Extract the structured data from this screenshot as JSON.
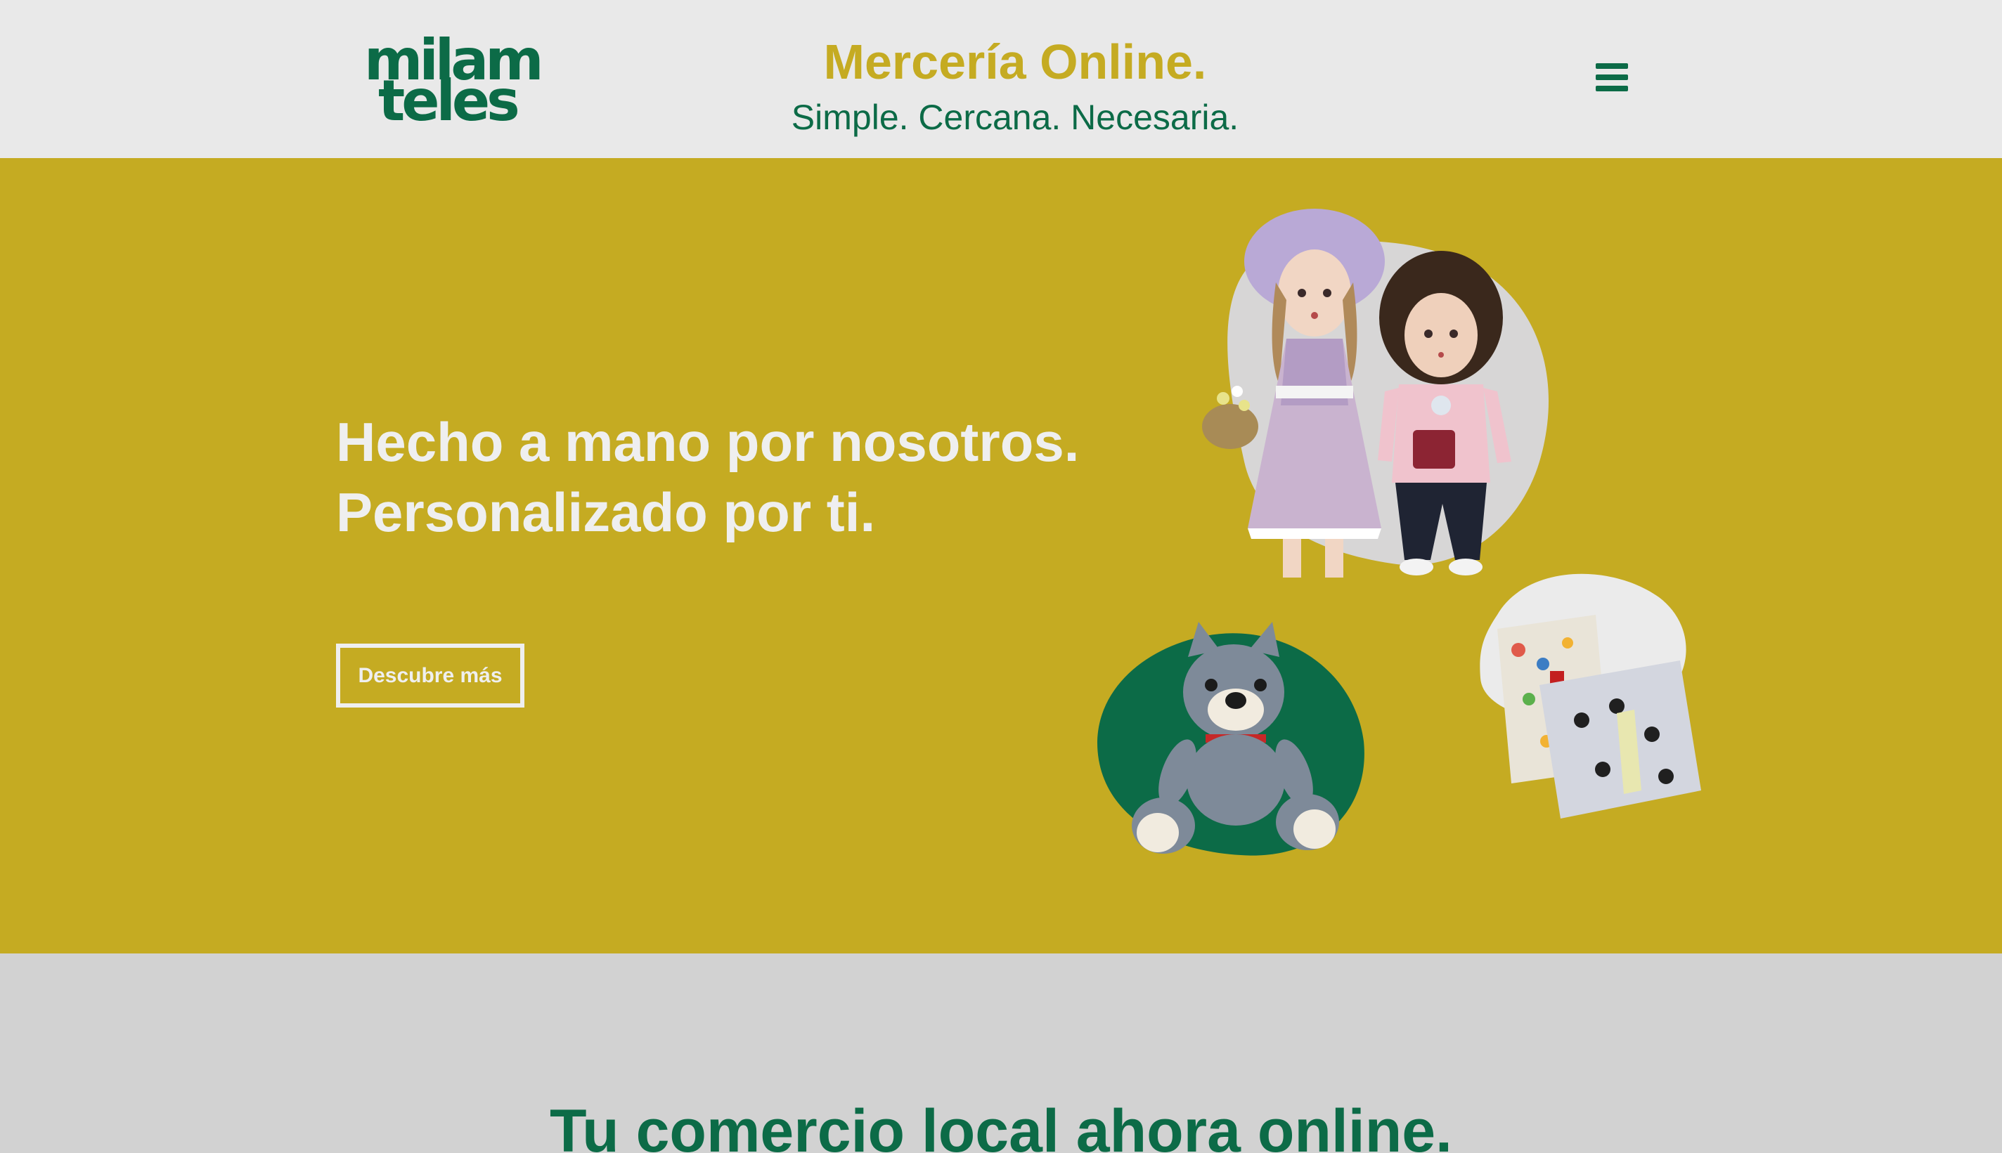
{
  "header": {
    "logo": {
      "line1": "milam",
      "line2": "teles"
    },
    "title": "Mercería Online.",
    "subtitle": "Simple. Cercana. Necesaria.",
    "menu_icon": "hamburger-menu-icon"
  },
  "hero": {
    "heading_line1": "Hecho a mano por nosotros.",
    "heading_line2": "Personalizado por ti.",
    "cta_label": "Descubre más",
    "images": [
      "rag-dolls",
      "crochet-bear",
      "fabric-pouches"
    ]
  },
  "section2": {
    "title": "Tu comercio local ahora online."
  },
  "colors": {
    "brand_green": "#0c6b47",
    "brand_mustard": "#c5ab22",
    "header_bg": "#e9e9e9",
    "section_gray": "#d2d2d2",
    "hero_text": "#efefef"
  }
}
